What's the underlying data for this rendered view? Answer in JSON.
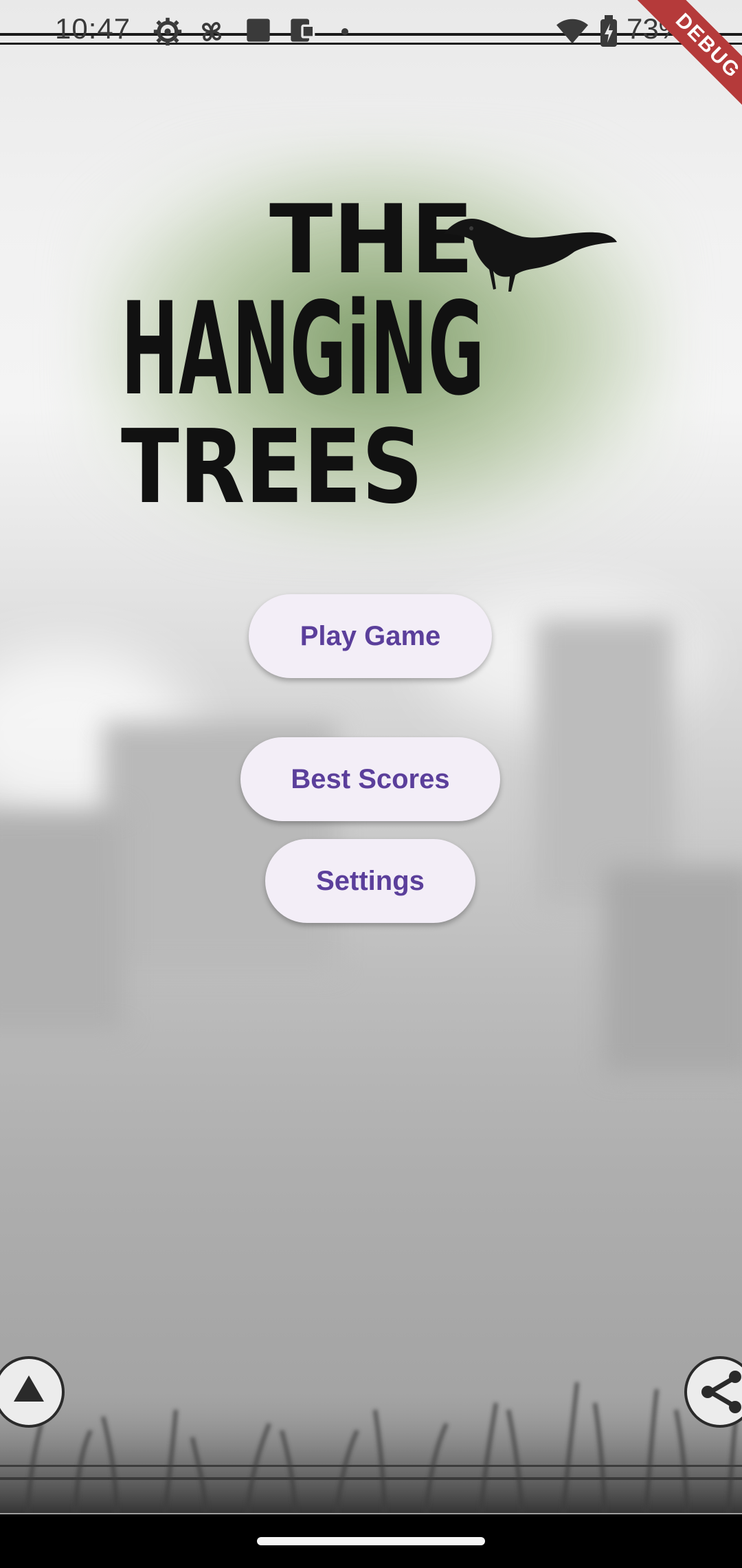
{
  "status_bar": {
    "time": "10:47",
    "battery_text": "73%",
    "icons": [
      "settings-gear-icon",
      "pinwheel-icon",
      "square-app-icon",
      "phone-app-icon",
      "dot-icon",
      "wifi-icon",
      "battery-charging-icon"
    ]
  },
  "debug_banner": "DEBUG",
  "logo": {
    "line1": "THE",
    "line2": "HANGiNG",
    "line3": "TREES",
    "bird_icon": "crow-icon"
  },
  "menu": {
    "play": "Play Game",
    "scores": "Best Scores",
    "settings": "Settings"
  },
  "controls": {
    "left_icon": "triangle-up-icon",
    "right_icon": "share-icon"
  },
  "colors": {
    "button_bg": "#f3eef7",
    "button_text": "#5b3f9b",
    "debug_ribbon": "#b53a3a"
  }
}
